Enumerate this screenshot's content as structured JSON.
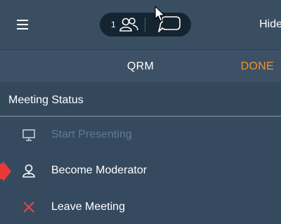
{
  "topbar": {
    "participant_count": "1",
    "hide_label": "Hide"
  },
  "subbar": {
    "title": "QRM",
    "done_label": "DONE"
  },
  "menu": {
    "section_title": "Meeting Status",
    "items": [
      {
        "label": "Start Presenting",
        "icon": "monitor-icon",
        "enabled": false
      },
      {
        "label": "Become Moderator",
        "icon": "moderator-icon",
        "enabled": true
      },
      {
        "label": "Leave Meeting",
        "icon": "close-icon",
        "enabled": true
      }
    ]
  },
  "colors": {
    "panel": "#354a5f",
    "accent": "#f0922b",
    "leave_red": "#e8454a",
    "annotation_arrow": "#e8393a"
  }
}
